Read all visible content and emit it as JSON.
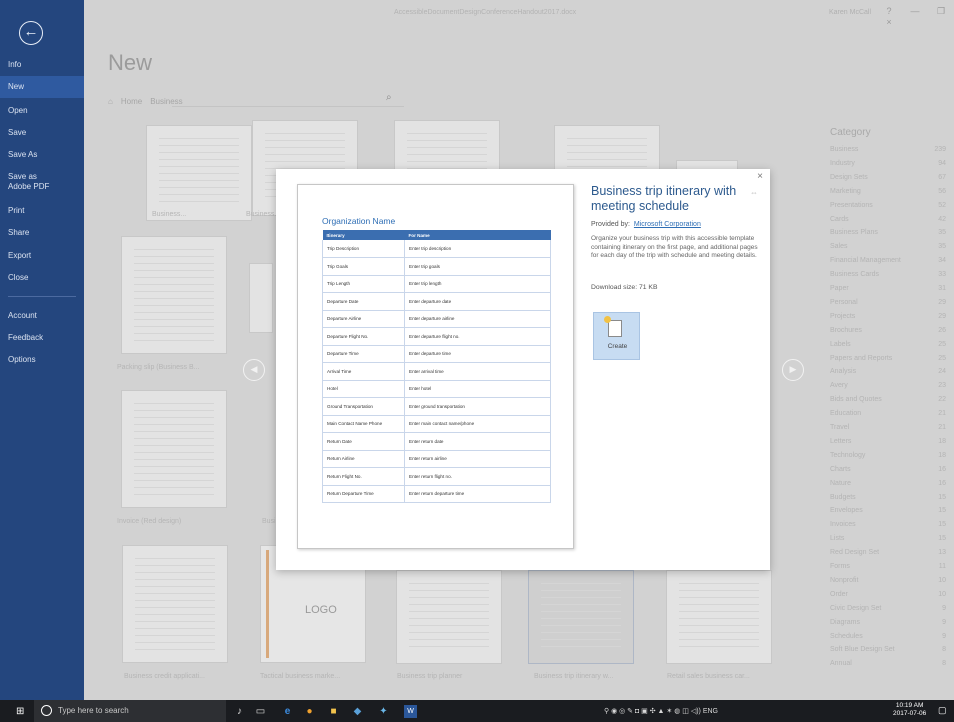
{
  "window": {
    "doc_title": "AccessibleDocumentDesignConferenceHandout2017.docx",
    "user": "Karen McCall",
    "help": "?",
    "minimize": "—",
    "restore": "❐",
    "close": "×"
  },
  "sidebar": {
    "back": "←",
    "items": [
      {
        "label": "Info"
      },
      {
        "label": "New"
      },
      {
        "label": "Open"
      },
      {
        "label": "Save"
      },
      {
        "label": "Save As"
      },
      {
        "label": "Save as Adobe PDF"
      },
      {
        "label": "Print"
      },
      {
        "label": "Share"
      },
      {
        "label": "Export"
      },
      {
        "label": "Close"
      },
      {
        "label": "Account"
      },
      {
        "label": "Feedback"
      },
      {
        "label": "Options"
      }
    ]
  },
  "main": {
    "heading": "New",
    "crumb_home": "Home",
    "crumb_current": "Business",
    "thumbnails": [
      {
        "label": "Business..."
      },
      {
        "label": "Business..."
      },
      {
        "label": "Packing slip (Business B..."
      },
      {
        "label": "Invoice (Red design)"
      },
      {
        "label": "Busi..."
      },
      {
        "label": "Business credit applicati..."
      },
      {
        "label": "Tactical business marke..."
      },
      {
        "label": "Business trip planner"
      },
      {
        "label": "Business trip itinerary w..."
      },
      {
        "label": "Retail sales business car..."
      }
    ],
    "logo_text": "LOGO"
  },
  "categories": {
    "heading": "Category",
    "items": [
      {
        "name": "Business",
        "count": "239"
      },
      {
        "name": "Industry",
        "count": "94"
      },
      {
        "name": "Design Sets",
        "count": "67"
      },
      {
        "name": "Marketing",
        "count": "56"
      },
      {
        "name": "Presentations",
        "count": "52"
      },
      {
        "name": "Cards",
        "count": "42"
      },
      {
        "name": "Business Plans",
        "count": "35"
      },
      {
        "name": "Sales",
        "count": "35"
      },
      {
        "name": "Financial Management",
        "count": "34"
      },
      {
        "name": "Business Cards",
        "count": "33"
      },
      {
        "name": "Paper",
        "count": "31"
      },
      {
        "name": "Personal",
        "count": "29"
      },
      {
        "name": "Projects",
        "count": "29"
      },
      {
        "name": "Brochures",
        "count": "26"
      },
      {
        "name": "Labels",
        "count": "25"
      },
      {
        "name": "Papers and Reports",
        "count": "25"
      },
      {
        "name": "Analysis",
        "count": "24"
      },
      {
        "name": "Avery",
        "count": "23"
      },
      {
        "name": "Bids and Quotes",
        "count": "22"
      },
      {
        "name": "Education",
        "count": "21"
      },
      {
        "name": "Travel",
        "count": "21"
      },
      {
        "name": "Letters",
        "count": "18"
      },
      {
        "name": "Technology",
        "count": "18"
      },
      {
        "name": "Charts",
        "count": "16"
      },
      {
        "name": "Nature",
        "count": "16"
      },
      {
        "name": "Budgets",
        "count": "15"
      },
      {
        "name": "Envelopes",
        "count": "15"
      },
      {
        "name": "Invoices",
        "count": "15"
      },
      {
        "name": "Lists",
        "count": "15"
      },
      {
        "name": "Red Design Set",
        "count": "13"
      },
      {
        "name": "Forms",
        "count": "11"
      },
      {
        "name": "Nonprofit",
        "count": "10"
      },
      {
        "name": "Order",
        "count": "10"
      },
      {
        "name": "Civic Design Set",
        "count": "9"
      },
      {
        "name": "Diagrams",
        "count": "9"
      },
      {
        "name": "Schedules",
        "count": "9"
      },
      {
        "name": "Soft Blue Design Set",
        "count": "8"
      },
      {
        "name": "Annual",
        "count": "8"
      }
    ]
  },
  "modal": {
    "close": "×",
    "pin": "⇔",
    "title": "Business trip itinerary with meeting schedule",
    "provided_by_label": "Provided by:",
    "provider": "Microsoft Corporation",
    "description": "Organize your business trip with this accessible template containing itinerary on the first page, and additional pages for each day of the trip with schedule and meeting details.",
    "download_size": "Download size:  71 KB",
    "create_label": "Create",
    "preview": {
      "org_name": "Organization Name",
      "headers": [
        "Itinerary",
        "For Name"
      ],
      "rows": [
        [
          "Trip Description",
          "Enter trip description"
        ],
        [
          "Trip Goals",
          "Enter trip goals"
        ],
        [
          "Trip Length",
          "Enter trip length"
        ],
        [
          "Departure Date",
          "Enter departure date"
        ],
        [
          "Departure Airline",
          "Enter departure airline"
        ],
        [
          "Departure Flight No.",
          "Enter departure flight no."
        ],
        [
          "Departure Time",
          "Enter departure time"
        ],
        [
          "Arrival Time",
          "Enter arrival time"
        ],
        [
          "Hotel",
          "Enter hotel"
        ],
        [
          "Ground Transportation",
          "Enter ground transportation"
        ],
        [
          "Main Contact Name Phone",
          "Enter main contact name/phone"
        ],
        [
          "Return Date",
          "Enter return date"
        ],
        [
          "Return Airline",
          "Enter return airline"
        ],
        [
          "Return Flight No.",
          "Enter return flight no."
        ],
        [
          "Return Departure Time",
          "Enter return departure time"
        ]
      ]
    }
  },
  "taskbar": {
    "search_placeholder": "Type here to search",
    "language": "ENG",
    "time": "10:19 AM",
    "date": "2017-07-06"
  }
}
